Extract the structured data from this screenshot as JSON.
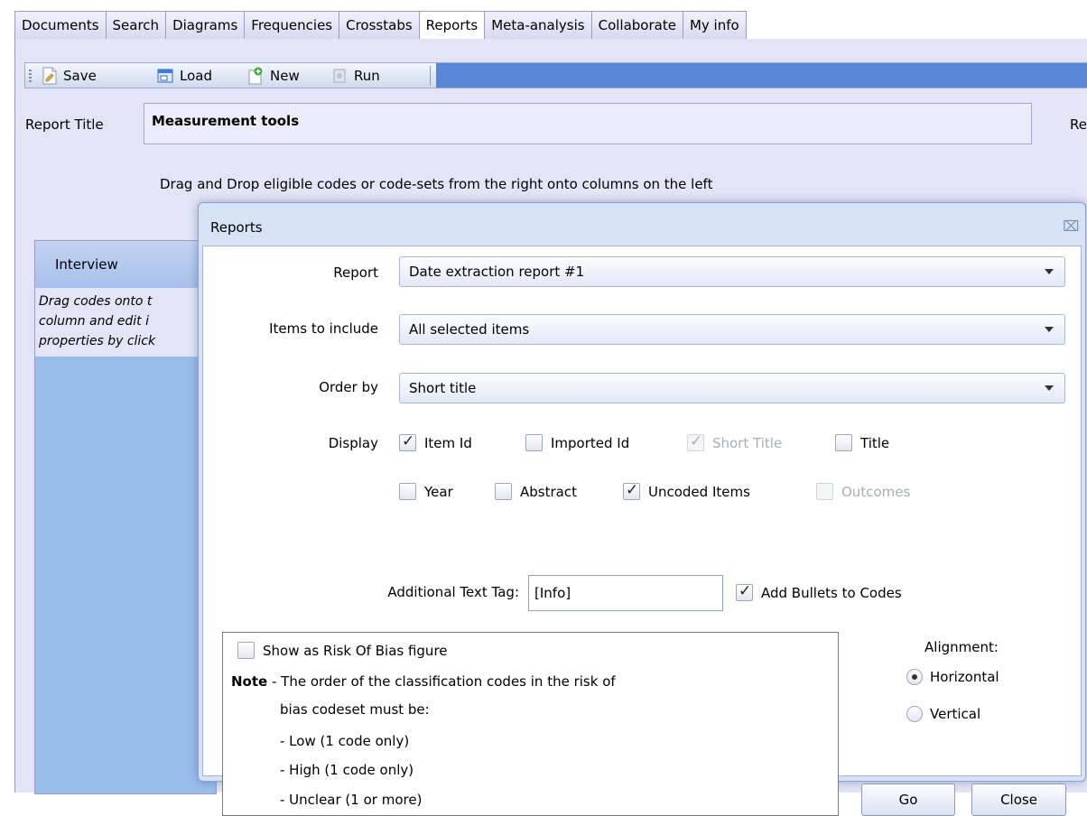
{
  "tabs": [
    "Documents",
    "Search",
    "Diagrams",
    "Frequencies",
    "Crosstabs",
    "Reports",
    "Meta-analysis",
    "Collaborate",
    "My info"
  ],
  "active_tab": "Reports",
  "toolbar": {
    "save": "Save",
    "load": "Load",
    "new": "New",
    "run": "Run"
  },
  "report_title": {
    "label": "Report Title",
    "value": "Measurement tools",
    "right_clip": "Rep"
  },
  "drag_hint": "Drag and Drop eligible codes or code-sets from the right onto columns on the left",
  "column": {
    "header": "Interview",
    "body_lines": [
      "Drag codes onto t",
      "column and edit i",
      "properties by click"
    ]
  },
  "dialog": {
    "title": "Reports",
    "close": "⌧",
    "report": {
      "label": "Report",
      "value": "Date extraction report #1"
    },
    "items": {
      "label": "Items to include",
      "value": "All selected items"
    },
    "order": {
      "label": "Order by",
      "value": "Short title"
    },
    "display": {
      "label": "Display",
      "options": [
        {
          "label": "Item Id",
          "checked": true,
          "disabled": false
        },
        {
          "label": "Imported Id",
          "checked": false,
          "disabled": false
        },
        {
          "label": "Short Title",
          "checked": true,
          "disabled": true
        },
        {
          "label": "Title",
          "checked": false,
          "disabled": false
        },
        {
          "label": "Year",
          "checked": false,
          "disabled": false
        },
        {
          "label": "Abstract",
          "checked": false,
          "disabled": false
        },
        {
          "label": "Uncoded Items",
          "checked": true,
          "disabled": false
        },
        {
          "label": "Outcomes",
          "checked": false,
          "disabled": true
        }
      ]
    },
    "text_tag": {
      "label": "Additional Text Tag:",
      "value": "[Info]"
    },
    "bullets": {
      "label": "Add Bullets to Codes",
      "checked": true
    },
    "risk_of_bias": {
      "label": "Show as Risk Of Bias figure",
      "checked": false,
      "note_bold": "Note",
      "note_text": "- The order of the classification codes in the risk of",
      "note_cont": "bias codeset must be:",
      "items": [
        "- Low (1 code only)",
        "- High (1 code only)",
        "- Unclear (1 or more)"
      ]
    },
    "alignment": {
      "label": "Alignment:",
      "options": [
        {
          "label": "Horizontal",
          "selected": true
        },
        {
          "label": "Vertical",
          "selected": false
        }
      ]
    },
    "go": "Go",
    "close_button": "Close"
  }
}
